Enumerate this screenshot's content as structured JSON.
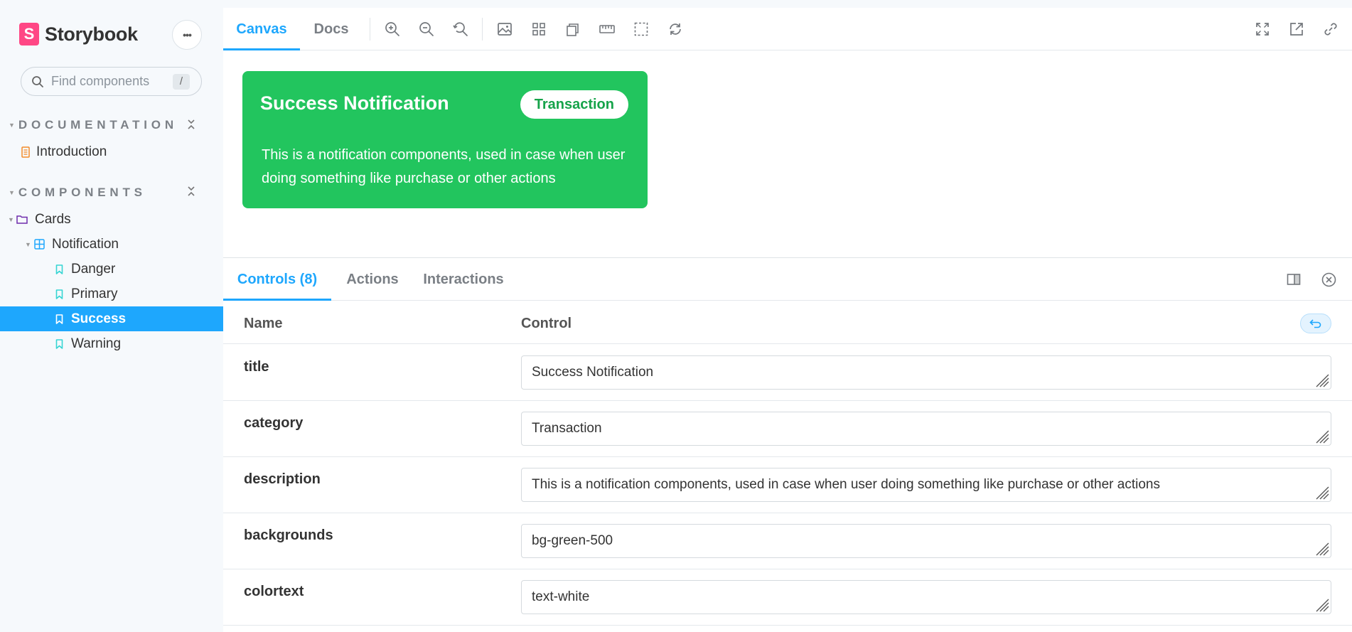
{
  "app": {
    "logo_letter": "S",
    "brand": "Storybook",
    "menu_label": "•••",
    "brand_color": "#ff4785",
    "accent_color": "#1ea7fd"
  },
  "search": {
    "placeholder": "Find components",
    "shortcut": "/"
  },
  "sidebar": {
    "sections": [
      {
        "label": "DOCUMENTATION"
      },
      {
        "label": "COMPONENTS"
      }
    ],
    "items": [
      {
        "label": "Introduction",
        "icon": "document-icon"
      },
      {
        "label": "Cards",
        "icon": "folder-icon"
      },
      {
        "label": "Notification",
        "icon": "component-icon"
      },
      {
        "label": "Danger",
        "icon": "bookmark-icon"
      },
      {
        "label": "Primary",
        "icon": "bookmark-icon"
      },
      {
        "label": "Success",
        "icon": "bookmark-icon",
        "selected": true
      },
      {
        "label": "Warning",
        "icon": "bookmark-icon"
      }
    ]
  },
  "toolbar": {
    "tabs": [
      {
        "label": "Canvas",
        "active": true
      },
      {
        "label": "Docs"
      }
    ],
    "tools": [
      "zoom-in-icon",
      "zoom-out-icon",
      "zoom-reset-icon",
      "background-icon",
      "grid-icon",
      "viewport-icon",
      "measure-icon",
      "outline-icon",
      "refresh-icon"
    ],
    "right_tools": [
      "fullscreen-icon",
      "open-new-tab-icon",
      "copy-link-icon"
    ]
  },
  "preview": {
    "title": "Success Notification",
    "badge": "Transaction",
    "description": "This is a notification components, used in case when user doing something like purchase or other actions",
    "background": "#22c55e",
    "text_color": "#ffffff"
  },
  "addons": {
    "tabs": [
      {
        "label": "Controls (8)",
        "active": true
      },
      {
        "label": "Actions"
      },
      {
        "label": "Interactions"
      }
    ]
  },
  "controls": {
    "header_name": "Name",
    "header_control": "Control",
    "rows": [
      {
        "name": "title",
        "value": "Success Notification"
      },
      {
        "name": "category",
        "value": "Transaction"
      },
      {
        "name": "description",
        "value": "This is a notification components, used in case when user doing something like purchase or other actions"
      },
      {
        "name": "backgrounds",
        "value": "bg-green-500"
      },
      {
        "name": "colortext",
        "value": "text-white"
      }
    ]
  }
}
